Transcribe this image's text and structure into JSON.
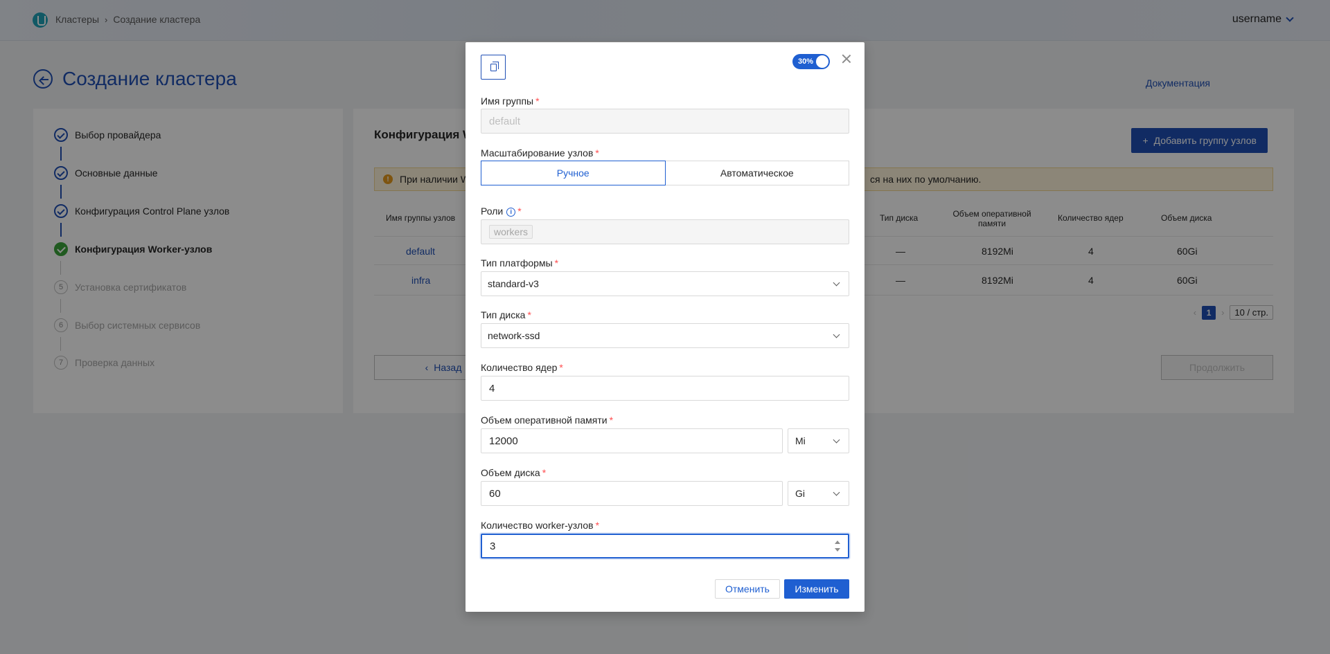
{
  "header": {
    "crumbs": [
      "Кластеры",
      "Создание кластера"
    ],
    "separator": "›",
    "username": "username"
  },
  "page": {
    "title": "Создание кластера",
    "doc_link": "Документация"
  },
  "steps": [
    {
      "label": "Выбор провайдера",
      "state": "done"
    },
    {
      "label": "Основные данные",
      "state": "done"
    },
    {
      "label": "Конфигурация Control Plane узлов",
      "state": "done"
    },
    {
      "label": "Конфигурация Worker-узлов",
      "state": "active"
    },
    {
      "label": "Установка сертификатов",
      "state": "todo",
      "num": "5"
    },
    {
      "label": "Выбор системных сервисов",
      "state": "todo",
      "num": "6"
    },
    {
      "label": "Проверка данных",
      "state": "todo",
      "num": "7"
    }
  ],
  "main": {
    "heading": "Конфигурация W",
    "add_button": "Добавить группу узлов",
    "alert_start": "При наличии W",
    "alert_end": "ся на них по умолчанию.",
    "columns": [
      "Имя группы узлов",
      "Тип диска",
      "Объем оперативной памяти",
      "Количество ядер",
      "Объем диска"
    ],
    "rows": [
      {
        "name": "default",
        "disk": "—",
        "ram": "8192Mi",
        "cores": "4",
        "size": "60Gi"
      },
      {
        "name": "infra",
        "disk": "—",
        "ram": "8192Mi",
        "cores": "4",
        "size": "60Gi"
      }
    ],
    "pager": {
      "page": "1",
      "size": "10 / стр."
    },
    "back_button": "Назад",
    "next_button": "Продолжить"
  },
  "modal": {
    "toggle_label": "30%",
    "group_name": {
      "label": "Имя группы",
      "value": "default"
    },
    "scaling": {
      "label": "Масштабирование узлов",
      "options": [
        "Ручное",
        "Автоматическое"
      ],
      "selected": "Ручное"
    },
    "roles": {
      "label": "Роли",
      "tag": "workers"
    },
    "platform": {
      "label": "Тип платформы",
      "value": "standard-v3"
    },
    "disk_type": {
      "label": "Тип диска",
      "value": "network-ssd"
    },
    "cores": {
      "label": "Количество ядер",
      "value": "4"
    },
    "ram": {
      "label": "Объем оперативной памяти",
      "value": "12000",
      "unit": "Mi"
    },
    "disk": {
      "label": "Объем диска",
      "value": "60",
      "unit": "Gi"
    },
    "workers": {
      "label": "Количество worker-узлов",
      "value": "3"
    },
    "cancel_button": "Отменить",
    "submit_button": "Изменить"
  },
  "colors": {
    "primary": "#1f4fb5",
    "accent": "#1f5fd1",
    "success": "#3ba53b",
    "required": "#ff4d4f"
  }
}
